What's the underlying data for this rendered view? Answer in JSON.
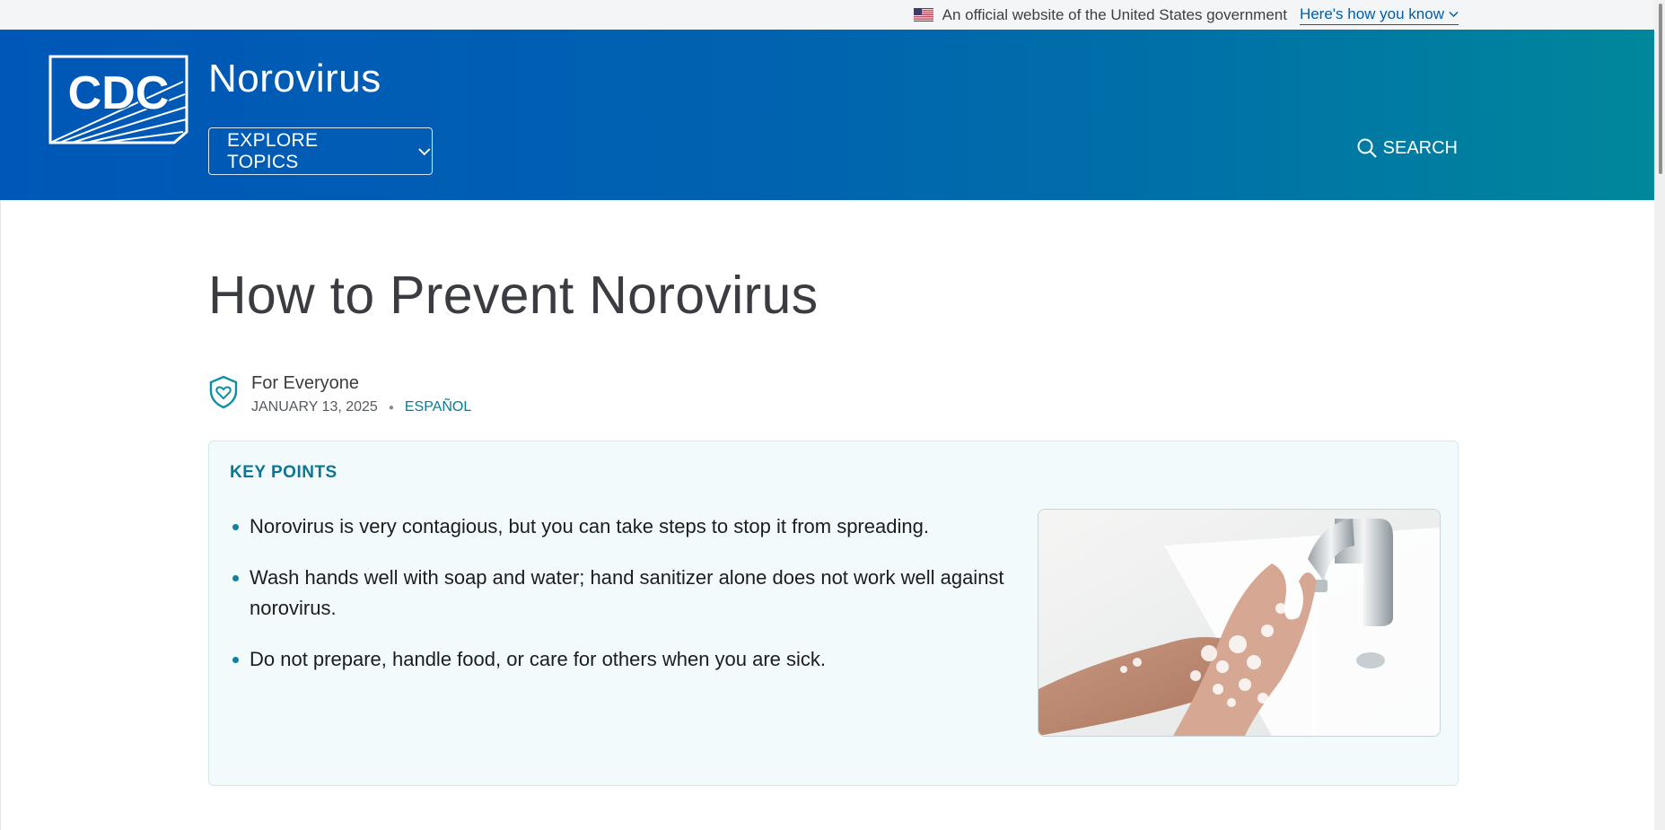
{
  "gov_banner": {
    "text": "An official website of the United States government",
    "link": "Here's how you know",
    "icon": "us-flag-icon"
  },
  "header": {
    "logo_text": "CDC",
    "site_title": "Norovirus",
    "explore_label": "EXPLORE TOPICS",
    "search_label": "SEARCH",
    "colors": {
      "gradient_start": "#0057b7",
      "gradient_end": "#00889b"
    }
  },
  "page": {
    "title": "How to Prevent Norovirus",
    "audience": "For Everyone",
    "audience_icon": "shield-heart-icon",
    "date": "JANUARY 13, 2025",
    "language_link": "ESPAÑOL"
  },
  "key_points": {
    "heading": "KEY POINTS",
    "items": [
      "Norovirus is very contagious, but you can take steps to stop it from spreading.",
      "Wash hands well with soap and water; hand sanitizer alone does not work well against norovirus.",
      "Do not prepare, handle food, or care for others when you are sick."
    ],
    "image_alt": "hand-washing-photo",
    "accent_color": "#0c7596"
  }
}
